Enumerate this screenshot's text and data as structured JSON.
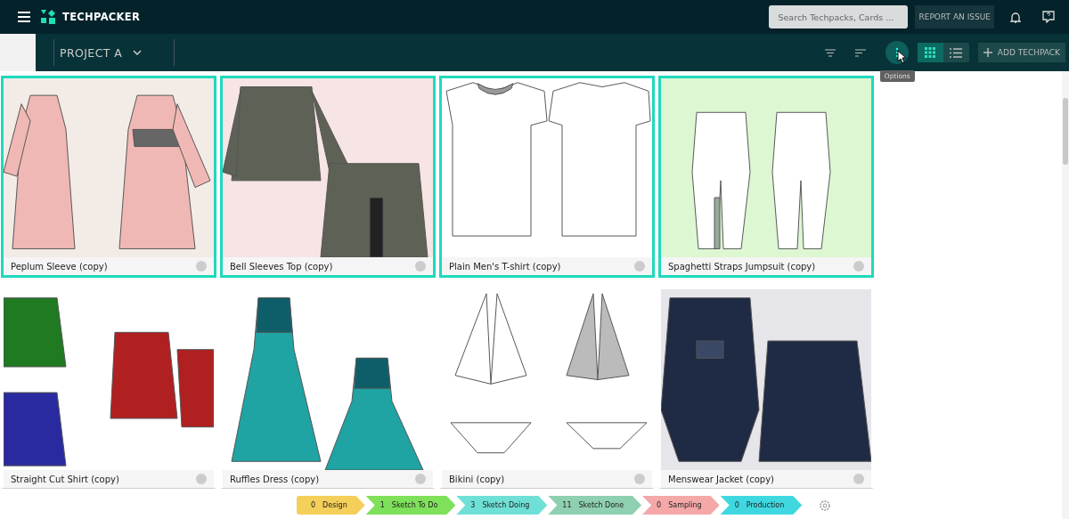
{
  "app": {
    "name": "TECHPACKER"
  },
  "search": {
    "placeholder": "Search Techpacks, Cards ..."
  },
  "report_button": "REPORT AN ISSUE",
  "project": {
    "name": "PROJECT A"
  },
  "view_modes": [
    {
      "kind": "grid",
      "selected": true
    },
    {
      "kind": "list",
      "selected": false
    }
  ],
  "add_button": "ADD TECHPACK",
  "tooltip": "Options",
  "cards": [
    {
      "title": "Peplum Sleeve (copy)",
      "selected": true
    },
    {
      "title": "Bell Sleeves Top (copy)",
      "selected": true
    },
    {
      "title": "Plain Men's T-shirt (copy)",
      "selected": true
    },
    {
      "title": "Spaghetti Straps Jumpsuit (copy)",
      "selected": true
    },
    {
      "title": "Straight Cut Shirt (copy)",
      "selected": false
    },
    {
      "title": "Ruffles Dress (copy)",
      "selected": false
    },
    {
      "title": "Bikini (copy)",
      "selected": false
    },
    {
      "title": "Menswear Jacket (copy)",
      "selected": false
    }
  ],
  "stages": [
    {
      "count": "0",
      "label": "Design",
      "color": "#f4cf5a"
    },
    {
      "count": "1",
      "label": "Sketch To Do",
      "color": "#7fe05a"
    },
    {
      "count": "3",
      "label": "Sketch Doing",
      "color": "#6fe0d6"
    },
    {
      "count": "11",
      "label": "Sketch Done",
      "color": "#8fd0b0"
    },
    {
      "count": "0",
      "label": "Sampling",
      "color": "#f4a8a8"
    },
    {
      "count": "0",
      "label": "Production",
      "color": "#3fd8e0"
    }
  ]
}
